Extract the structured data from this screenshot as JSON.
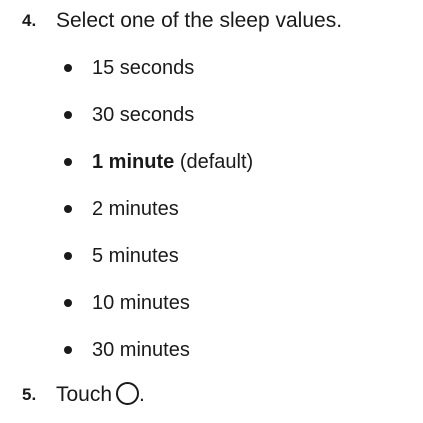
{
  "steps": [
    {
      "number": "4.",
      "text": "Select one of the sleep values."
    },
    {
      "number": "5.",
      "text": "Touch",
      "suffix": ".",
      "icon": "circle-icon"
    }
  ],
  "sleep_values": [
    {
      "label": "15 seconds",
      "note": ""
    },
    {
      "label": "30 seconds",
      "note": ""
    },
    {
      "label": "1 minute",
      "note": "(default)",
      "bold": true
    },
    {
      "label": "2 minutes",
      "note": ""
    },
    {
      "label": "5 minutes",
      "note": ""
    },
    {
      "label": "10 minutes",
      "note": ""
    },
    {
      "label": "30 minutes",
      "note": ""
    }
  ]
}
